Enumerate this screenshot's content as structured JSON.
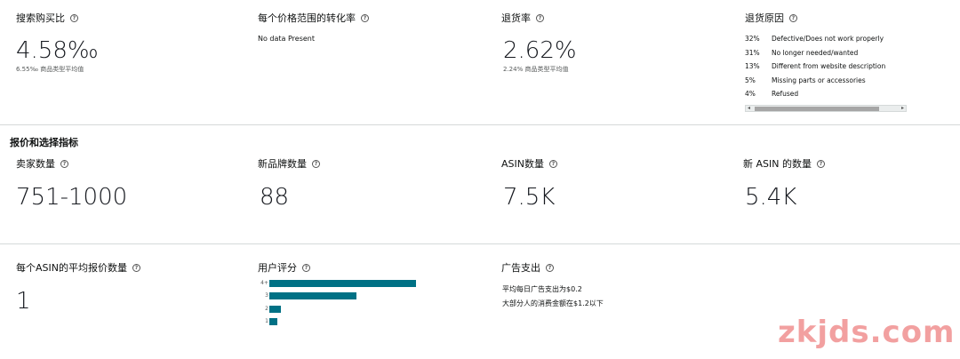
{
  "top": {
    "search_purchase": {
      "title": "搜索购买比",
      "value": "4.58‰",
      "sub": "6.55‰ 商品类型平均值"
    },
    "price_conversion": {
      "title": "每个价格范围的转化率",
      "nodata": "No data Present"
    },
    "return_rate": {
      "title": "退货率",
      "value": "2.62%",
      "sub": "2.24% 商品类型平均值"
    },
    "return_reasons": {
      "title": "退货原因",
      "items": [
        {
          "pct": "32%",
          "label": "Defective/Does not work properly"
        },
        {
          "pct": "31%",
          "label": "No longer needed/wanted"
        },
        {
          "pct": "13%",
          "label": "Different from website description"
        },
        {
          "pct": "5%",
          "label": "Missing parts or accessories"
        },
        {
          "pct": "4%",
          "label": "Refused"
        }
      ]
    }
  },
  "section_title": "报价和选择指标",
  "metrics": {
    "sellers": {
      "title": "卖家数量",
      "value": "751-1000"
    },
    "new_brands": {
      "title": "新品牌数量",
      "value": "88"
    },
    "asin_count": {
      "title": "ASIN数量",
      "value": "7.5K"
    },
    "new_asin": {
      "title": "新 ASIN 的数量",
      "value": "5.4K"
    }
  },
  "bottom": {
    "avg_offers": {
      "title": "每个ASIN的平均报价数量",
      "value": "1"
    },
    "ratings": {
      "title": "用户评分",
      "bars": [
        {
          "label": "4+",
          "value": 1.0
        },
        {
          "label": "3",
          "value": 0.594
        },
        {
          "label": "2",
          "value": 0.081
        },
        {
          "label": "1",
          "value": 0.054
        }
      ]
    },
    "ad_spend": {
      "title": "广告支出",
      "line1": "平均每日广告支出为$0.2",
      "line2": "大部分人的消费金额在$1.2以下"
    }
  },
  "watermark": "zkjds.com"
}
